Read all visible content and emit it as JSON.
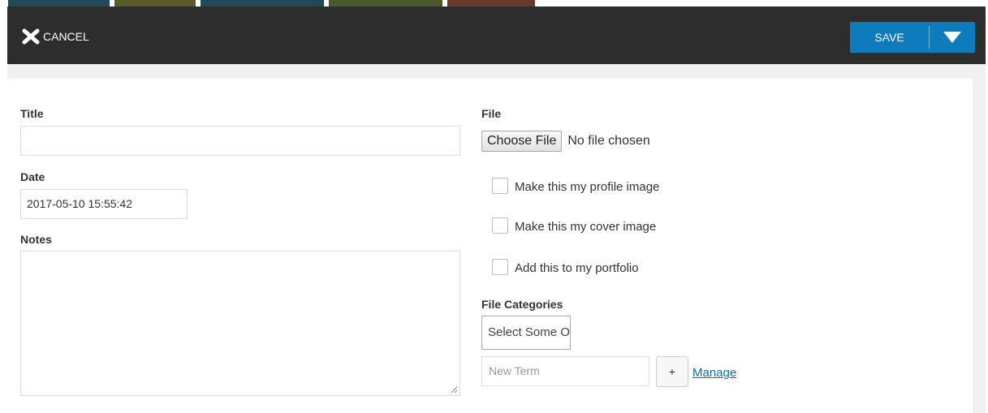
{
  "toolbar": {
    "cancel_label": "CANCEL",
    "save_label": "SAVE",
    "cancel_icon": "close-icon",
    "save_dropdown_icon": "caret-down-icon",
    "background": "#2d2d2d",
    "save_color": "#0e7bbd"
  },
  "form": {
    "title_label": "Title",
    "title_value": "",
    "date_label": "Date",
    "date_value": "2017-05-10 15:55:42",
    "notes_label": "Notes",
    "notes_value": "",
    "file_label": "File",
    "choose_file_label": "Choose File",
    "no_file_text": "No file chosen",
    "checkboxes": [
      {
        "label": "Make this my profile image",
        "checked": false
      },
      {
        "label": "Make this my cover image",
        "checked": false
      },
      {
        "label": "Add this to my portfolio",
        "checked": false
      }
    ],
    "categories_label": "File Categories",
    "categories_select": "Select Some Options",
    "new_term_placeholder": "New Term",
    "add_term_label": "+",
    "manage_label": "Manage",
    "link_color": "#0e6bab"
  },
  "top_strip_colors": [
    "#1f4a5a",
    "#5b5a2a",
    "#1f4a5a",
    "#4a5a2a",
    "#6a3a2a"
  ]
}
